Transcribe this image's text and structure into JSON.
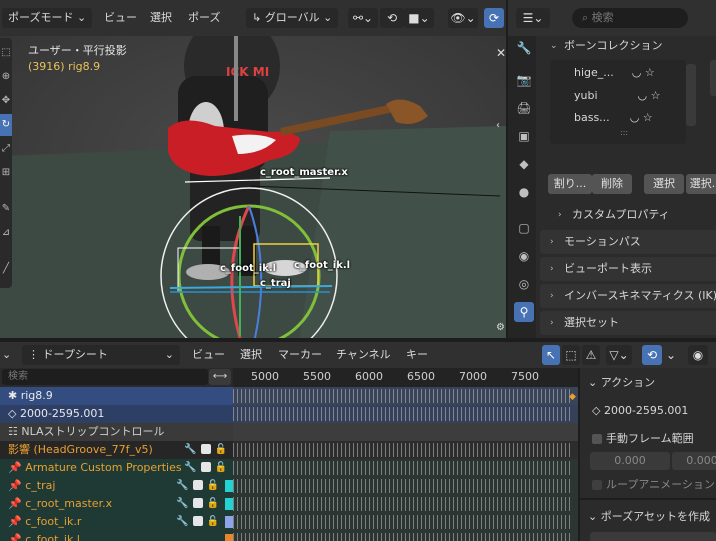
{
  "header": {
    "mode": "ポーズモード",
    "menus": [
      "ビュー",
      "選択",
      "ポーズ"
    ],
    "transform_orientation": "グローバル"
  },
  "viewport": {
    "title": "ユーザー・平行投影",
    "subtitle": "(3916) rig8.9",
    "bone_labels": [
      "c_root_master.x",
      "c_foot_ik.l",
      "c_foot_ik.l",
      "c_traj"
    ]
  },
  "properties": {
    "search_placeholder": "検索",
    "bone_collection_title": "ボーンコレクション",
    "collections": [
      "hige_...",
      "yubi",
      "bass..."
    ],
    "buttons": {
      "assign": "割り...",
      "remove": "削除",
      "select": "選択",
      "deselect": "選択..."
    },
    "sections": [
      "カスタムプロパティ",
      "モーションパス",
      "ビューポート表示",
      "インバースキネマティクス (IK)",
      "選択セット"
    ]
  },
  "dopesheet": {
    "mode": "ドープシート",
    "menus": [
      "ビュー",
      "選択",
      "マーカー",
      "チャンネル",
      "キー"
    ],
    "search_placeholder": "検索",
    "ruler_ticks": [
      "5000",
      "5500",
      "6000",
      "6500",
      "7000",
      "7500"
    ],
    "channels": [
      {
        "label": "rig8.9",
        "kind": "object"
      },
      {
        "label": "2000-2595.001",
        "kind": "action"
      },
      {
        "label": "NLAストリップコントロール",
        "kind": "nla"
      },
      {
        "label": "影響 (HeadGroove_77f_v5)",
        "kind": "influence"
      },
      {
        "label": "Armature Custom Properties",
        "kind": "group",
        "color": ""
      },
      {
        "label": "c_traj",
        "kind": "group",
        "color": "#22d3d3"
      },
      {
        "label": "c_root_master.x",
        "kind": "group",
        "color": "#22d3d3"
      },
      {
        "label": "c_foot_ik.r",
        "kind": "group",
        "color": "#8fa3e8"
      },
      {
        "label": "c_foot_ik.l",
        "kind": "group",
        "color": "#e8862a"
      }
    ]
  },
  "action_panel": {
    "title": "アクション",
    "action_name": "2000-2595.001",
    "manual_frame_range": "手動フレーム範囲",
    "start": "0.000",
    "end": "0.000",
    "loop": "ループアニメーション",
    "pose_asset": "ポーズアセットを作成"
  },
  "colors": {
    "accent": "#4772b3",
    "selected_row": "#334d80",
    "group_row": "#1f3a34"
  }
}
